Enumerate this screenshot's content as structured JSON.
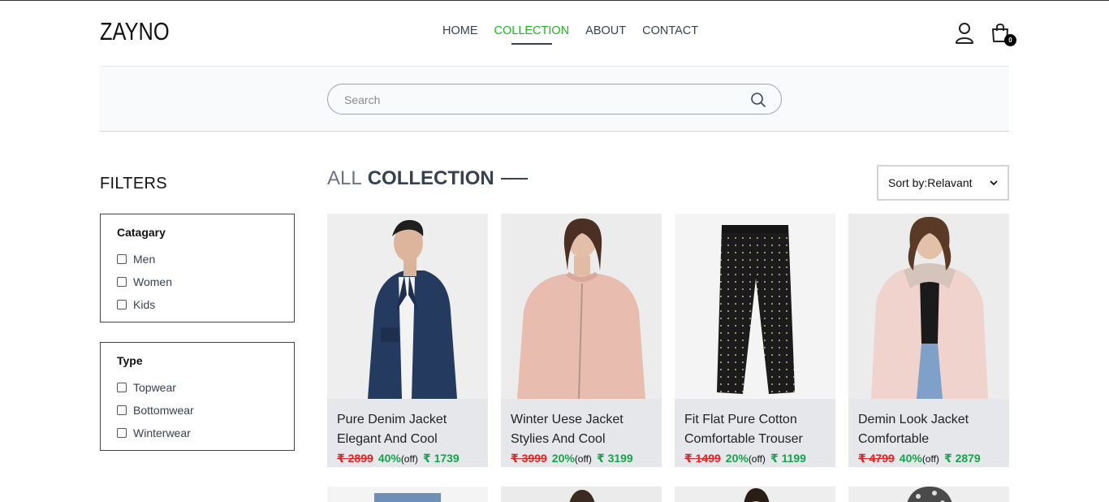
{
  "brand": {
    "logo": "ZAYNO"
  },
  "nav": [
    {
      "label": "HOME",
      "active": false
    },
    {
      "label": "COLLECTION",
      "active": true
    },
    {
      "label": "ABOUT",
      "active": false
    },
    {
      "label": "CONTACT",
      "active": false
    }
  ],
  "cart": {
    "count": "0"
  },
  "search": {
    "placeholder": "Search",
    "value": ""
  },
  "filters": {
    "title": "FILTERS",
    "category": {
      "heading": "Catagary",
      "options": [
        "Men",
        "Women",
        "Kids"
      ]
    },
    "type": {
      "heading": "Type",
      "options": [
        "Topwear",
        "Bottomwear",
        "Winterwear"
      ]
    }
  },
  "collection": {
    "title_light": "ALL",
    "title_bold": "COLLECTION",
    "sort_label": "Sort by:Relavant"
  },
  "products": [
    {
      "name": "Pure Denim Jacket Elegant And Cool",
      "old_price": "₹ 2899",
      "discount": "40%",
      "off": "(off)",
      "price": "₹ 1739",
      "image": "denim-jacket-man"
    },
    {
      "name": "Winter Uese Jacket Stylies And Cool",
      "old_price": "₹ 3999",
      "discount": "20%",
      "off": "(off)",
      "price": "₹ 3199",
      "image": "pink-bomber-woman"
    },
    {
      "name": "Fit Flat Pure Cotton Comfortable Trouser",
      "old_price": "₹ 1499",
      "discount": "20%",
      "off": "(off)",
      "price": "₹ 1199",
      "image": "black-dotted-trouser"
    },
    {
      "name": "Demin Look Jacket Comfortable",
      "old_price": "₹ 4799",
      "discount": "40%",
      "off": "(off)",
      "price": "₹ 2879",
      "image": "pink-puffer-woman"
    }
  ],
  "colors": {
    "accent": "#22b322",
    "strike": "#dc2626",
    "price": "#16a34a",
    "card_bg": "#e5e7eb"
  }
}
